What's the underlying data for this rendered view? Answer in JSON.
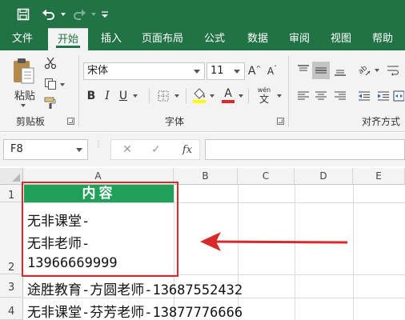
{
  "colors": {
    "accent": "#217346",
    "annotation": "#d9292a",
    "header_fill": "#21a05a"
  },
  "quick_access": {
    "save_icon": "save-icon",
    "undo_icon": "undo-icon",
    "redo_icon": "redo-icon",
    "customize_icon": "customize-dropdown-icon"
  },
  "tabs": [
    "文件",
    "开始",
    "插入",
    "页面布局",
    "公式",
    "数据",
    "审阅",
    "视图",
    "帮助"
  ],
  "active_tab": "开始",
  "ribbon": {
    "clipboard": {
      "paste_label": "粘贴",
      "group_label": "剪贴板"
    },
    "font": {
      "font_name": "宋体",
      "font_size": "11",
      "bold": "B",
      "italic": "I",
      "underline": "U",
      "grow": "A",
      "shrink": "A",
      "color_letter": "A",
      "phonetic": "wén",
      "group_label": "字体"
    },
    "alignment": {
      "group_label": "对齐方式"
    }
  },
  "formula_bar": {
    "name_box": "F8",
    "cancel": "✕",
    "enter": "✓",
    "function": "fx",
    "value": ""
  },
  "sheet": {
    "columns": [
      "A",
      "B",
      "C",
      "D",
      "E"
    ],
    "rows": [
      "1",
      "2",
      "3",
      "4"
    ],
    "a1": "内容",
    "a2_lines": [
      "无非课堂-",
      "无非老师-",
      "13966669999"
    ],
    "a3": "途胜教育-方圆老师-13687552432",
    "a4": "无非课堂-芬芳老师-13877776666"
  }
}
